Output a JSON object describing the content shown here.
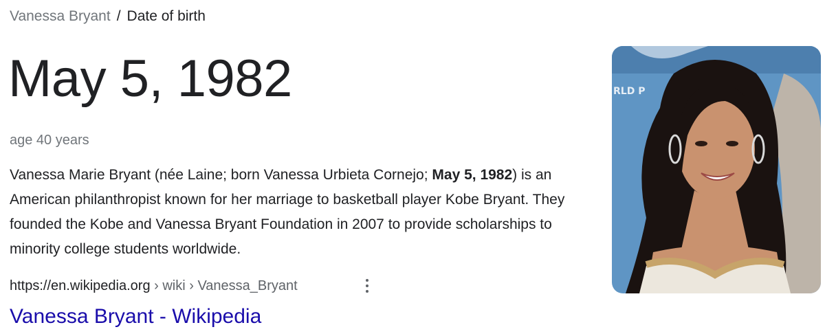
{
  "breadcrumb": {
    "parent": "Vanessa Bryant",
    "separator": "/",
    "current": "Date of birth"
  },
  "answer": {
    "value": "May 5, 1982",
    "age": "age 40 years"
  },
  "snippet": {
    "before": "Vanessa Marie Bryant (née Laine; born Vanessa Urbieta Cornejo; ",
    "highlight": "May 5, 1982",
    "after": ") is an American philanthropist known for her marriage to basketball player Kobe Bryant. They founded the Kobe and Vanessa Bryant Foundation in 2007 to provide scholarships to minority college students worldwide."
  },
  "source": {
    "domain": "https://en.wikipedia.org",
    "path": " › wiki › Vanessa_Bryant",
    "more_icon": "more-vert-icon",
    "title": "Vanessa Bryant - Wikipedia"
  },
  "image": {
    "backdrop_text": "RLD P",
    "colors": {
      "background": "#5f95c4",
      "hair": "#1a1210",
      "skin": "#c9926f",
      "dress": "#ece7dd",
      "trim": "#c7a46a"
    }
  },
  "colors": {
    "link": "#1a0dab",
    "text": "#202124",
    "muted": "#70757a"
  }
}
